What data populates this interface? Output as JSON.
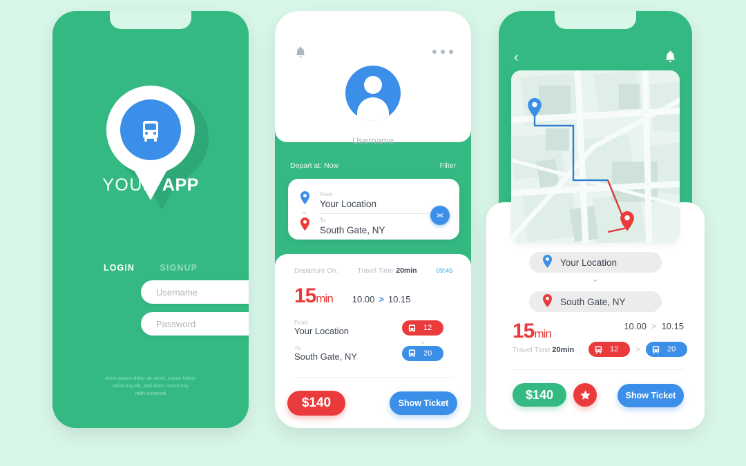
{
  "theme": {
    "background": "#d9f7e9",
    "green": "#35b983",
    "blue": "#3b8fe8",
    "red": "#e93b3b",
    "grey_pill": "#ececec"
  },
  "screen1": {
    "name": "login-screen",
    "brand_light": "YOUR ",
    "brand_bold": "APP",
    "logo_icon": "bus-pin-icon",
    "tabs": [
      {
        "label": "LOGIN",
        "active": true
      },
      {
        "label": "SIGNUP",
        "active": false
      }
    ],
    "fields": [
      {
        "name": "username",
        "placeholder": "Username",
        "value": ""
      },
      {
        "name": "password",
        "placeholder": "Password",
        "value": ""
      }
    ],
    "footer_lines": [
      "orem ipsum dolor sit amet, conse tetuer",
      "adisicing elit, sed diam nonummy",
      "nibh euismod"
    ]
  },
  "screen2": {
    "name": "search-results-screen",
    "bell_icon": "bell-icon",
    "more_icon": "more-dots-icon",
    "avatar_icon": "user-avatar-icon",
    "username": "Username",
    "depart_at": "Depart at: Now",
    "filter": "Filter",
    "location_card": {
      "from_label": "From",
      "from_value": "Your Location",
      "from_pin": "map-pin-blue-icon",
      "to_label": "To",
      "to_value": "South Gate, NY",
      "to_pin": "map-pin-red-icon",
      "swap_icon": "swap-vertical-icon"
    },
    "trip": {
      "departure_label": "Departure On:",
      "travel_time_label": "Travel Time",
      "travel_time_value": "20min",
      "clock": "09:45",
      "duration_number": "15",
      "duration_unit": "min",
      "start_time": "10.00",
      "arrow": ">",
      "end_time": "10.15",
      "from_label": "From",
      "from_value": "Your Location",
      "to_label": "To",
      "to_value": "South Gate, NY",
      "routes": [
        {
          "icon": "bus-icon",
          "number": "12",
          "color": "red"
        },
        {
          "icon": "bus-icon",
          "number": "20",
          "color": "blue"
        }
      ]
    },
    "price": "$140",
    "show_ticket": "Show Ticket"
  },
  "screen3": {
    "name": "route-detail-screen",
    "back_icon": "chevron-left-icon",
    "bell_icon": "bell-icon",
    "map": {
      "name": "route-map",
      "start_pin": "map-pin-blue-icon",
      "end_pin": "map-pin-red-icon",
      "leg1_color": "#2f7fd0",
      "leg2_color": "#d93b3b"
    },
    "from_value": "Your Location",
    "from_pin": "map-pin-blue-icon",
    "to_value": "South Gate, NY",
    "to_pin": "map-pin-red-icon",
    "duration_number": "15",
    "duration_unit": "min",
    "start_time": "10.00",
    "arrow": ">",
    "end_time": "10.15",
    "travel_time_label": "Travel Time",
    "travel_time_value": "20min",
    "routes": [
      {
        "icon": "bus-icon",
        "number": "12",
        "color": "red"
      },
      {
        "icon": "bus-icon",
        "number": "20",
        "color": "blue"
      }
    ],
    "price": "$140",
    "favorite_icon": "star-icon",
    "show_ticket": "Show Ticket"
  }
}
